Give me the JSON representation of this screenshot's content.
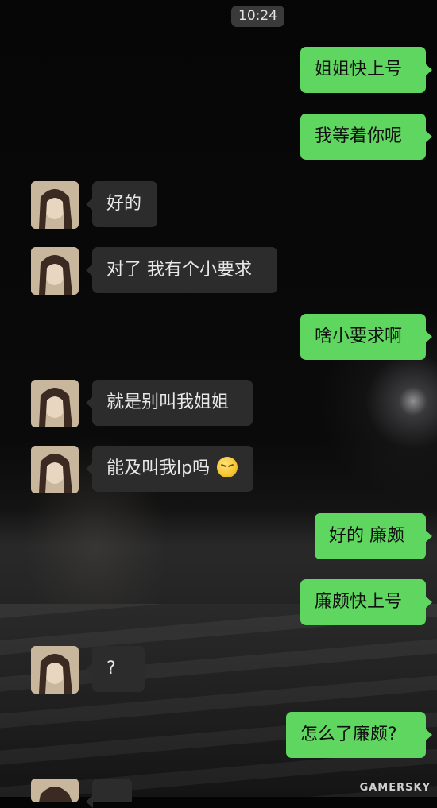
{
  "status": {
    "time": "10:24"
  },
  "messages": [
    {
      "side": "out",
      "text": "姐姐快上号"
    },
    {
      "side": "out",
      "text": "我等着你呢"
    },
    {
      "side": "in",
      "text": "好的"
    },
    {
      "side": "in",
      "text": "对了 我有个小要求"
    },
    {
      "side": "out",
      "text": "啥小要求啊"
    },
    {
      "side": "in",
      "text": "就是别叫我姐姐"
    },
    {
      "side": "in",
      "text": "能及叫我lp吗",
      "emoji": "blushing-emoji"
    },
    {
      "side": "out",
      "text": "好的 廉颇"
    },
    {
      "side": "out",
      "text": "廉颇快上号"
    },
    {
      "side": "in",
      "text": "?"
    },
    {
      "side": "out",
      "text": "怎么了廉颇?"
    }
  ],
  "watermark": "GAMERSKY",
  "colors": {
    "outgoing": "#5fd65f",
    "incoming": "#2c2c2c",
    "background": "#050505"
  }
}
